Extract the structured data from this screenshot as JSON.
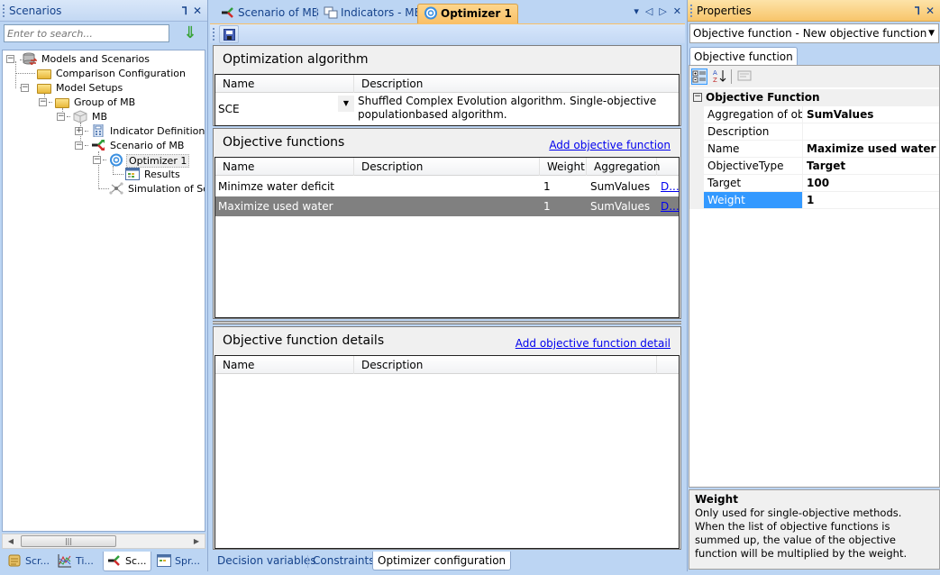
{
  "left_panel": {
    "title": "Scenarios",
    "pin_icon": "pin-icon",
    "close_icon": "close-icon",
    "search_placeholder": "Enter to search...",
    "search_go_icon": "down-arrow-icon",
    "tree": [
      {
        "label": "Models and Scenarios",
        "icon": "database-icon",
        "expander": "minus"
      },
      {
        "label": "Comparison Configuration",
        "icon": "folder-icon",
        "expander": ""
      },
      {
        "label": "Model Setups",
        "icon": "folder-icon",
        "expander": "minus"
      },
      {
        "label": "Group of MB",
        "icon": "folder-icon",
        "expander": "minus"
      },
      {
        "label": "MB",
        "icon": "model-cube-icon",
        "expander": "minus"
      },
      {
        "label": "Indicator Definitions",
        "icon": "calculator-icon",
        "expander": "plus"
      },
      {
        "label": "Scenario of MB",
        "icon": "scenario-icon",
        "expander": "minus"
      },
      {
        "label": "Optimizer 1",
        "icon": "optimizer-icon",
        "expander": "minus",
        "selected": true
      },
      {
        "label": "Results",
        "icon": "results-grid-icon",
        "expander": ""
      },
      {
        "label": "Simulation of Scer",
        "icon": "simulation-icon",
        "expander": ""
      }
    ],
    "bottom_tabs": [
      {
        "label": "Scr...",
        "icon": "script-icon"
      },
      {
        "label": "Ti...",
        "icon": "timeseries-chart-icon"
      },
      {
        "label": "Sc...",
        "icon": "scenario-icon",
        "active": true
      },
      {
        "label": "Spr...",
        "icon": "spreadsheet-icon"
      }
    ]
  },
  "center": {
    "doc_tabs": [
      {
        "label": "Scenario of MB",
        "icon": "scenario-icon"
      },
      {
        "label": "Indicators - MB",
        "icon": "indicators-icon"
      },
      {
        "label": "Optimizer 1",
        "icon": "optimizer-icon",
        "active": true
      }
    ],
    "tab_buttons": {
      "dropdown": "▾",
      "prev": "◁",
      "next": "▷",
      "close": "✕"
    },
    "toolbar": {
      "save_icon": "save-icon"
    },
    "optimization_algorithm": {
      "title": "Optimization algorithm",
      "columns": [
        "Name",
        "Description"
      ],
      "row": {
        "name": "SCE",
        "description_line1": "Shuffled Complex Evolution algorithm. Single-objective",
        "description_line2": "populationbased algorithm."
      }
    },
    "objective_functions": {
      "title": "Objective functions",
      "add_link": "Add objective function",
      "columns": [
        "Name",
        "Description",
        "Weight",
        "Aggregation"
      ],
      "rows": [
        {
          "name": "Minimze water deficit",
          "description": "",
          "weight": "1",
          "aggregation": "SumValues",
          "link": "D...",
          "selected": false
        },
        {
          "name": "Maximize used water",
          "description": "",
          "weight": "1",
          "aggregation": "SumValues",
          "link": "D...",
          "selected": true
        }
      ]
    },
    "objective_function_details": {
      "title": "Objective function details",
      "add_link": "Add objective function detail",
      "columns": [
        "Name",
        "Description"
      ]
    },
    "bottom_tabs": [
      {
        "label": "Decision variables"
      },
      {
        "label": "Constraints"
      },
      {
        "label": "Optimizer configuration",
        "active": true
      }
    ]
  },
  "properties": {
    "title": "Properties",
    "object_selector": "Objective function - New objective function",
    "tab": "Objective function",
    "toolbar": {
      "categorized_icon": "categorized-icon",
      "alphabetical_icon": "sort-az-icon",
      "property_pages_icon": "property-pages-icon"
    },
    "category": "Objective Function",
    "rows": [
      {
        "name": "Aggregation of obje",
        "value": "SumValues"
      },
      {
        "name": "Description",
        "value": ""
      },
      {
        "name": "Name",
        "value": "Maximize used water"
      },
      {
        "name": "ObjectiveType",
        "value": "Target"
      },
      {
        "name": "Target",
        "value": "100"
      },
      {
        "name": "Weight",
        "value": "1",
        "selected": true
      }
    ],
    "help": {
      "title": "Weight",
      "text": "Only used for single-objective methods. When the list of objective functions is summed up, the value of the objective function will be multiplied by the weight."
    }
  }
}
